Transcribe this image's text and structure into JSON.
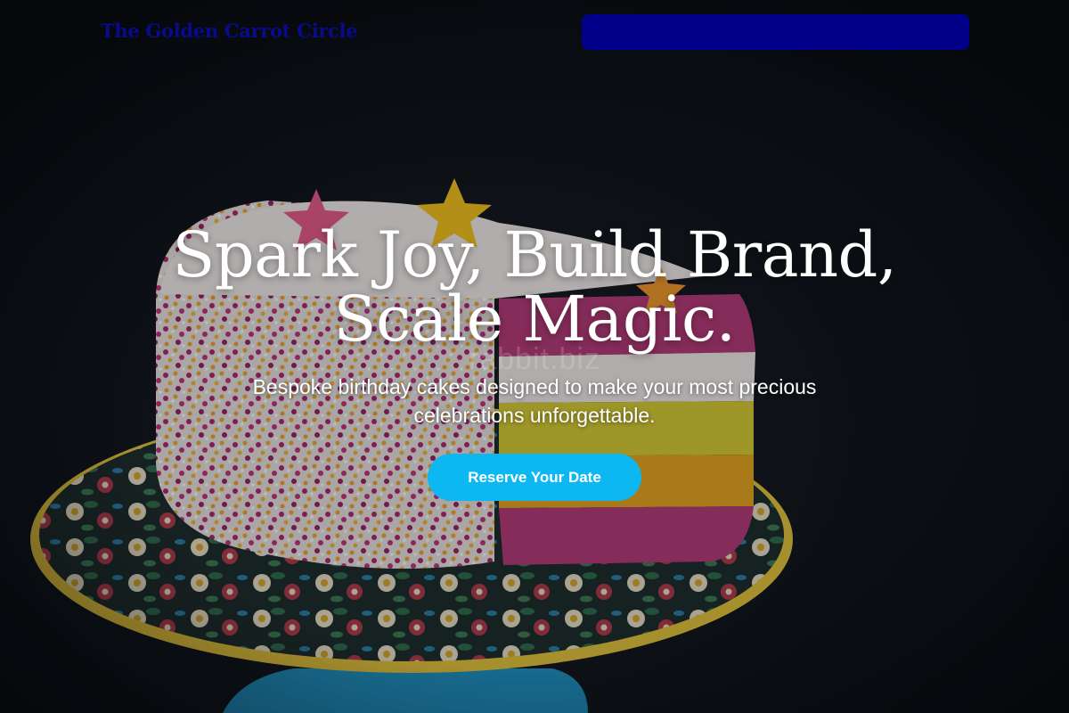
{
  "header": {
    "brand_name": "The Golden Carrot Circle",
    "nav_color": "#00008b"
  },
  "hero": {
    "image": "birthday-cake-photo",
    "title": "Spark Joy, Build Brand, Scale Magic.",
    "subtitle": "Bespoke birthday cakes designed to make your most precious celebrations unforgettable.",
    "cta_label": "Reserve Your Date",
    "cta_color": "#0db7f2",
    "watermark": "rabbit.biz"
  }
}
